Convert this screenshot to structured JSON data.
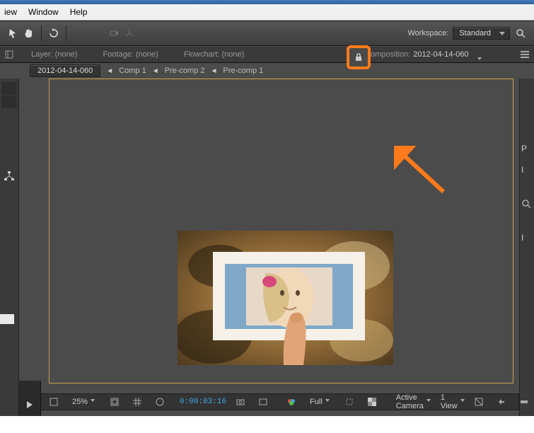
{
  "menu": {
    "view": "iew",
    "window": "Window",
    "help": "Help"
  },
  "workspace": {
    "label": "Workspace:",
    "value": "Standard"
  },
  "tabs": {
    "layer": "Layer: (none)",
    "footage": "Footage: (none)",
    "flowchart": "Flowchart: (none)",
    "composition": "omposition:",
    "comp_name": "2012-04-14-060"
  },
  "breadcrumb": {
    "items": [
      "2012-04-14-060",
      "Comp 1",
      "Pre-comp 2",
      "Pre-comp 1"
    ]
  },
  "viewer": {
    "zoom": "25%",
    "resolution": "Full",
    "timecode": "0:00:03:16",
    "camera": "Active Camera",
    "views": "1 View"
  }
}
